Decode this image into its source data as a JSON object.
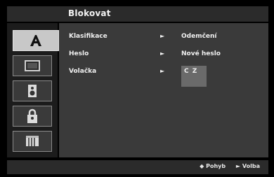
{
  "header": {
    "title": "Blokovat"
  },
  "sidebar": {
    "tabs": [
      {
        "icon": "language-a-icon",
        "active": true
      },
      {
        "icon": "display-icon",
        "active": false
      },
      {
        "icon": "speaker-icon",
        "active": false
      },
      {
        "icon": "lock-icon",
        "active": false
      },
      {
        "icon": "other-settings-icon",
        "active": false
      }
    ]
  },
  "menu": {
    "items": [
      {
        "label": "Klasifikace",
        "arrow": "►",
        "value": "Odemčení"
      },
      {
        "label": "Heslo",
        "arrow": "►",
        "value": "Nové heslo"
      },
      {
        "label": "Volačka",
        "arrow": "►",
        "value": "C Z"
      }
    ]
  },
  "footer": {
    "move_icon": "◆",
    "move_label": "Pohyb",
    "select_icon": "►",
    "select_label": "Volba"
  }
}
